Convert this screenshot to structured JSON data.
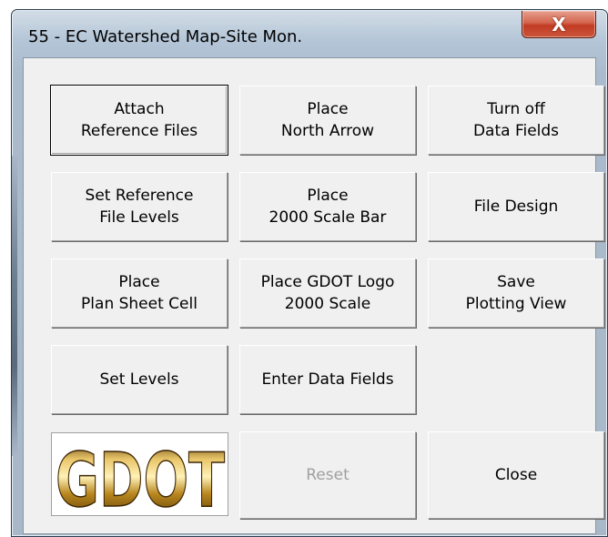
{
  "window": {
    "title": "55 - EC Watershed Map-Site Mon.",
    "close_glyph": "X"
  },
  "buttons": {
    "attach_reference_files": "Attach\nReference Files",
    "place_north_arrow": "Place\nNorth Arrow",
    "turn_off_data_fields": "Turn off\nData Fields",
    "set_reference_file_levels": "Set Reference\nFile Levels",
    "place_2000_scale_bar": "Place\n2000 Scale Bar",
    "file_design": "File Design",
    "place_plan_sheet_cell": "Place\nPlan Sheet Cell",
    "place_gdot_logo": "Place GDOT Logo\n2000 Scale",
    "save_plotting_view": "Save\nPlotting View",
    "set_levels": "Set Levels",
    "enter_data_fields": "Enter Data Fields",
    "reset": "Reset",
    "close": "Close"
  },
  "logo": {
    "text": "GDOT"
  }
}
